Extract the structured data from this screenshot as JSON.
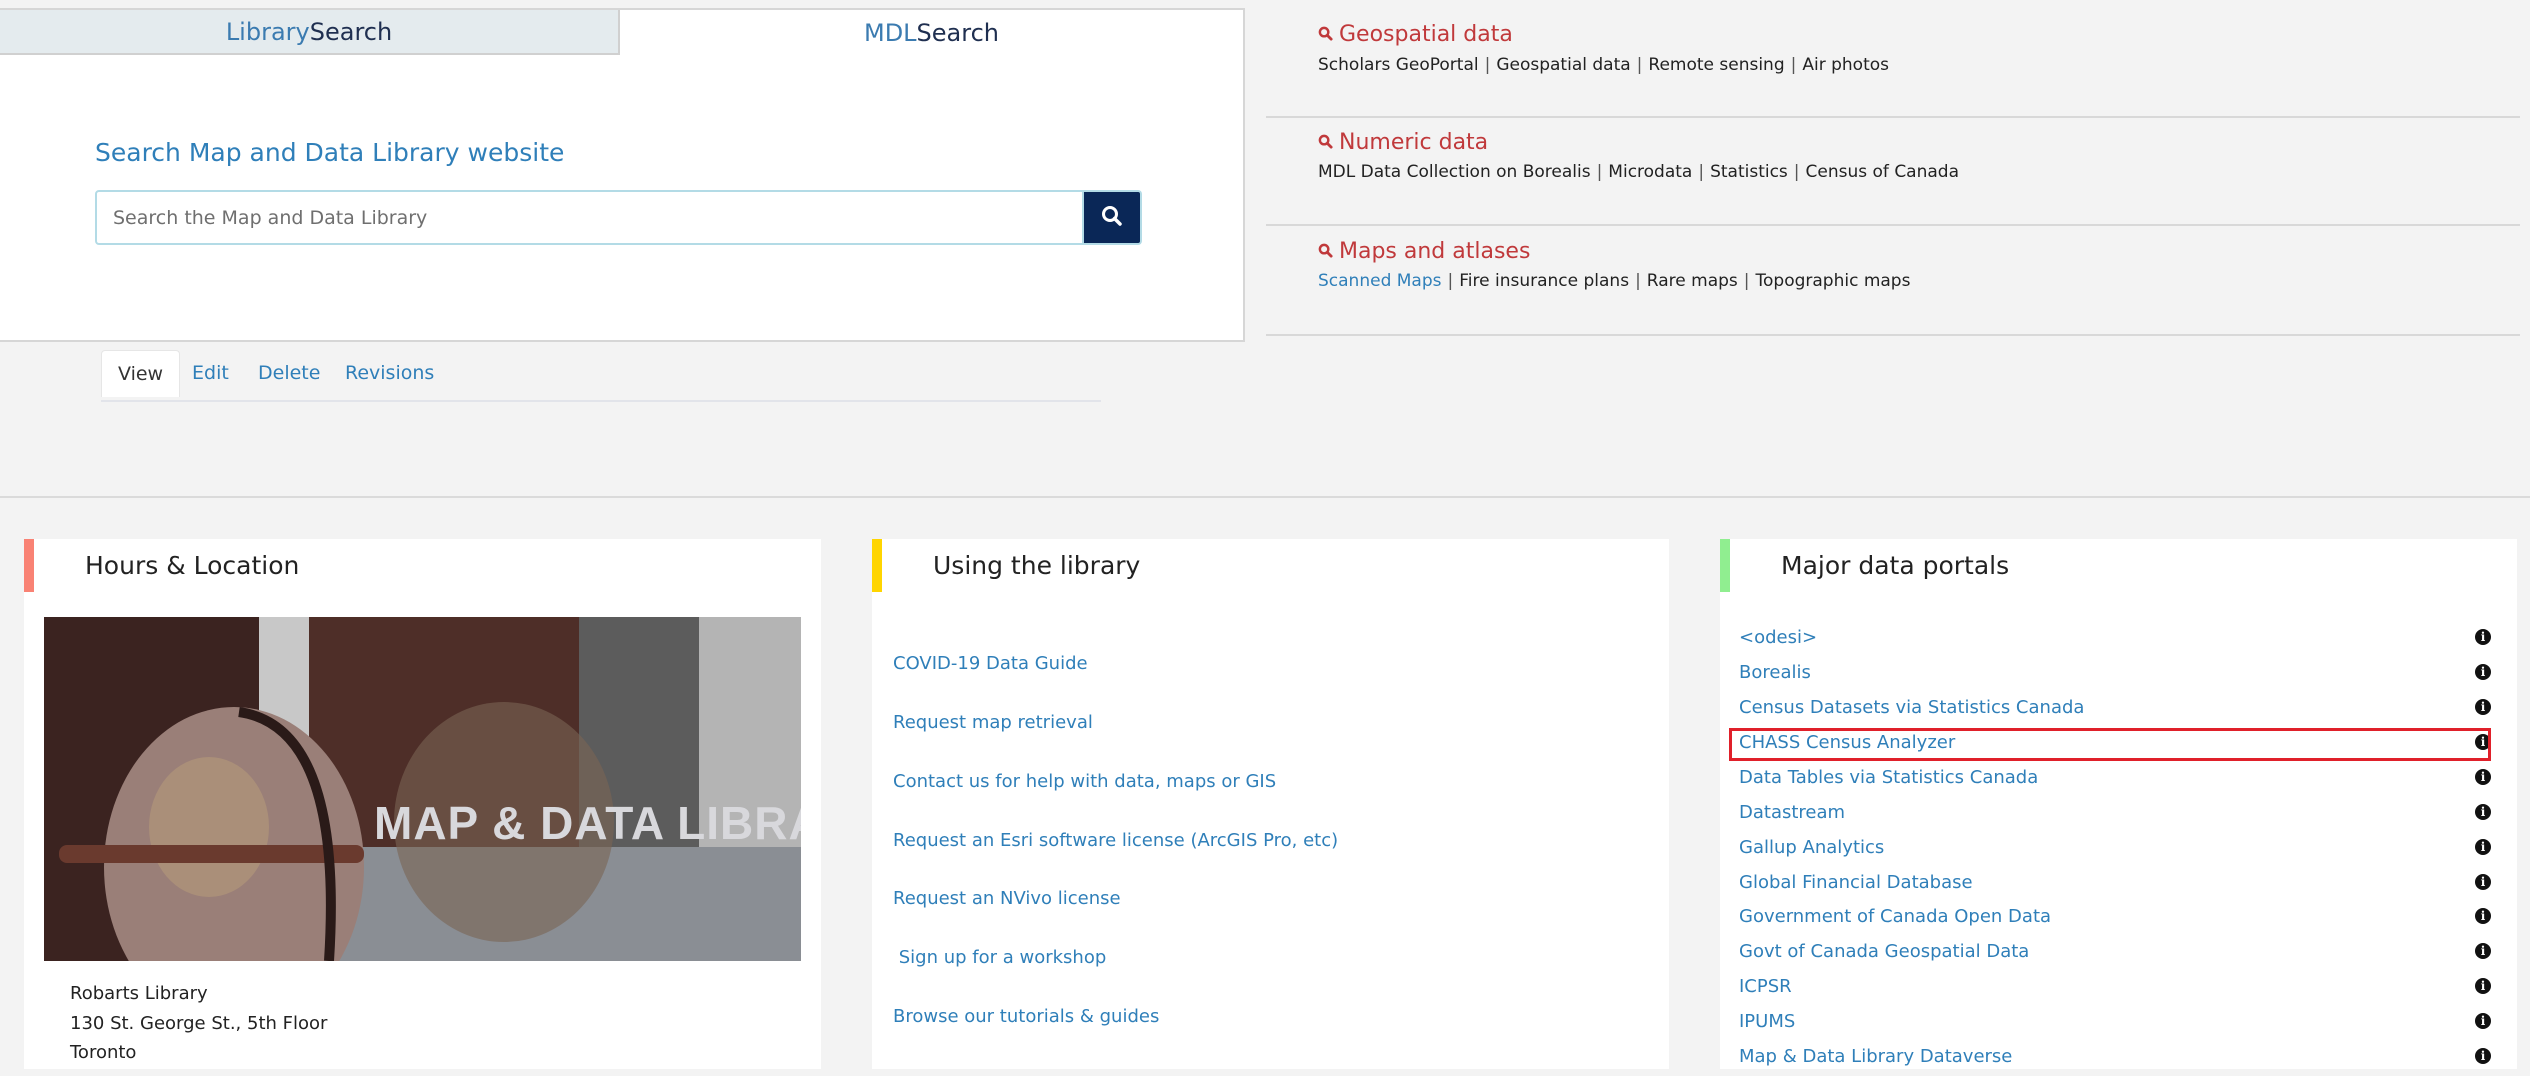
{
  "search_panel": {
    "tabs": [
      {
        "part1": "Library",
        "part2": "Search",
        "active": false
      },
      {
        "part1": "MDL",
        "part2": "Search",
        "active": true
      }
    ],
    "heading": "Search Map and Data Library website",
    "input_placeholder": "Search the Map and Data Library",
    "input_value": "",
    "search_button_icon": "search-icon"
  },
  "local_tabs": [
    {
      "label": "View",
      "active": true
    },
    {
      "label": "Edit",
      "active": false
    },
    {
      "label": "Delete",
      "active": false
    },
    {
      "label": "Revisions",
      "active": false
    }
  ],
  "quick_links": [
    {
      "title": "Geospatial data",
      "icon": "search-icon",
      "links": [
        {
          "label": "Scholars GeoPortal",
          "highlighted": false
        },
        {
          "label": "Geospatial data",
          "highlighted": false
        },
        {
          "label": "Remote sensing",
          "highlighted": false
        },
        {
          "label": "Air photos",
          "highlighted": false
        }
      ]
    },
    {
      "title": "Numeric data",
      "icon": "search-icon",
      "links": [
        {
          "label": "MDL Data Collection on Borealis",
          "highlighted": false
        },
        {
          "label": "Microdata",
          "highlighted": false
        },
        {
          "label": "Statistics",
          "highlighted": false
        },
        {
          "label": "Census of Canada",
          "highlighted": false
        }
      ]
    },
    {
      "title": "Maps and atlases",
      "icon": "search-icon",
      "links": [
        {
          "label": "Scanned Maps",
          "highlighted": true
        },
        {
          "label": "Fire insurance plans",
          "highlighted": false
        },
        {
          "label": "Rare maps",
          "highlighted": false
        },
        {
          "label": "Topographic maps",
          "highlighted": false
        }
      ]
    }
  ],
  "link_separator": "|",
  "cards": {
    "hours": {
      "title": "Hours & Location",
      "accent": "#f98274",
      "photo_alt": "MAP & DATA LIBRARY",
      "address": [
        "Robarts Library",
        "130 St. George St., 5th Floor",
        "Toronto"
      ]
    },
    "using": {
      "title": "Using the library",
      "accent": "#ffd500",
      "links": [
        "COVID-19 Data Guide",
        "Request map retrieval",
        "Contact us for help with data, maps or GIS",
        "Request an Esri software license (ArcGIS Pro, etc)",
        "Request an NVivo license",
        " Sign up for a workshop",
        "Browse our tutorials & guides"
      ]
    },
    "portals": {
      "title": "Major data portals",
      "accent": "#90ee90",
      "highlighted_item": "CHASS Census Analyzer",
      "items": [
        "<odesi>",
        "Borealis",
        "Census Datasets via Statistics Canada",
        "CHASS Census Analyzer",
        "Data Tables via Statistics Canada",
        "Datastream",
        "Gallup Analytics",
        "Global Financial Database",
        "Government of Canada Open Data",
        "Govt of Canada Geospatial Data",
        "ICPSR",
        "IPUMS",
        "Map & Data Library Dataverse"
      ],
      "info_icon": "info-icon"
    }
  },
  "colors": {
    "link": "#2f7fb9",
    "quick_link_title": "#c0393b",
    "search_button": "#0a2757",
    "highlight_box": "#e0202a"
  }
}
